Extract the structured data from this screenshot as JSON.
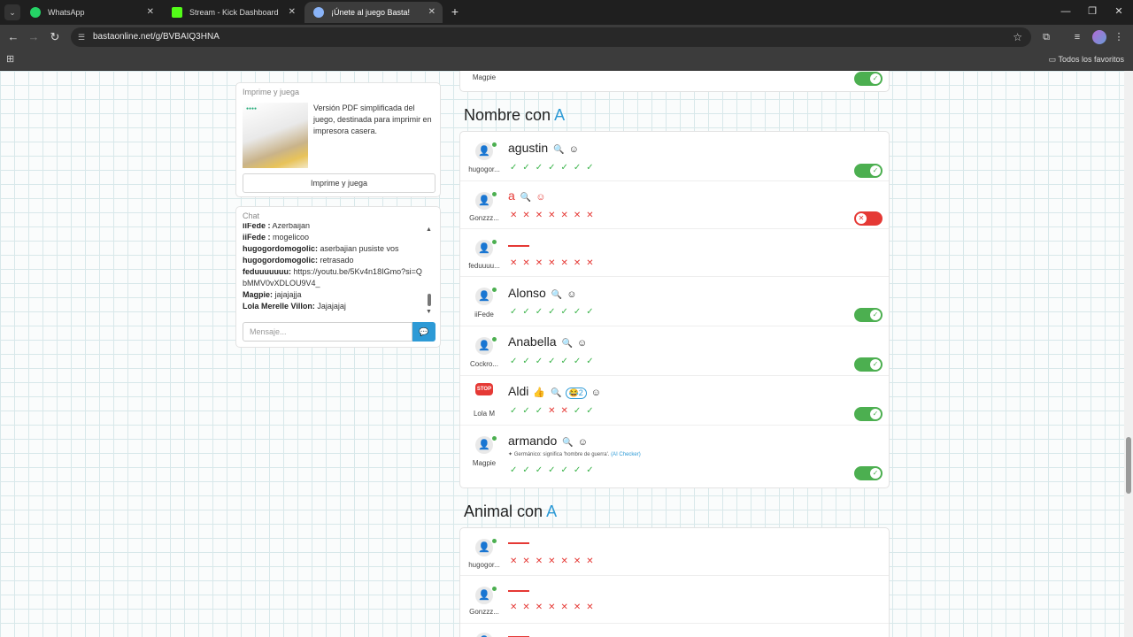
{
  "browser": {
    "tabs": [
      {
        "title": "WhatsApp",
        "icon": "whatsapp-icon",
        "color": "#25d366"
      },
      {
        "title": "Stream - Kick Dashboard",
        "icon": "kick-icon",
        "color": "#53fc18"
      },
      {
        "title": "¡Únete al juego Basta!",
        "icon": "globe-icon",
        "color": "#8ab4f8"
      }
    ],
    "url": "bastaonline.net/g/BVBAIQ3HNA",
    "bookmarks_label": "Todos los favoritos"
  },
  "print_card": {
    "title": "Imprime y juega",
    "description": "Versión PDF simplificada del juego, destinada para imprimir en impresora casera.",
    "button": "Imprime y juega"
  },
  "chat": {
    "title": "Chat",
    "messages": [
      {
        "user": "iiFede :",
        "text": "Azerbaijan"
      },
      {
        "user": "iiFede :",
        "text": "mogelicoo"
      },
      {
        "user": "hugogordomogolic:",
        "text": "aserbajian pusiste vos"
      },
      {
        "user": "hugogordomogolic:",
        "text": "retrasado"
      },
      {
        "user": "feduuuuuuu:",
        "text": "https://youtu.be/5Kv4n18IGmo?si=QbMMV0vXDLOU9V4_"
      },
      {
        "user": "Magpie:",
        "text": "jajajajja"
      },
      {
        "user": "Lola Merelle Villon:",
        "text": "Jajajajaj"
      }
    ],
    "placeholder": "Mensaje..."
  },
  "top_row": {
    "user": "Magpie",
    "marks": [
      "ok",
      "ok",
      "ok",
      "ok",
      "ok",
      "ok",
      "ok"
    ]
  },
  "section_nombre": {
    "title_prefix": "Nombre con ",
    "letter": "A",
    "rows": [
      {
        "user": "hugogor...",
        "word": "agustin",
        "marks": [
          "ok",
          "ok",
          "ok",
          "ok",
          "ok",
          "ok",
          "ok"
        ],
        "toggle": "on",
        "emoji_react": true
      },
      {
        "user": "Gonzzz...",
        "word": "a",
        "marks": [
          "no",
          "no",
          "no",
          "no",
          "no",
          "no",
          "no"
        ],
        "toggle": "off",
        "red": true,
        "emoji_react": true
      },
      {
        "user": "feduuuu...",
        "word": "",
        "marks": [
          "no",
          "no",
          "no",
          "no",
          "no",
          "no",
          "no"
        ],
        "toggle": "none"
      },
      {
        "user": "iiFede",
        "word": "Alonso",
        "marks": [
          "ok",
          "ok",
          "ok",
          "ok",
          "ok",
          "ok",
          "ok"
        ],
        "toggle": "on",
        "emoji_react": true
      },
      {
        "user": "Cockro...",
        "word": "Anabella",
        "marks": [
          "ok",
          "ok",
          "ok",
          "ok",
          "ok",
          "ok",
          "ok"
        ],
        "toggle": "on",
        "emoji_react": true
      },
      {
        "user": "Lola M",
        "word": "Aldi",
        "marks": [
          "ok",
          "ok",
          "ok",
          "no",
          "no",
          "ok",
          "ok"
        ],
        "toggle": "on",
        "stop": true,
        "badge": "😂2",
        "extra_emoji": "👍",
        "emoji_react": true
      },
      {
        "user": "Magpie",
        "word": "armando",
        "note": "Germánico: significa 'hombre de guerra'.",
        "note_tag": "(AI Checker)",
        "marks": [
          "ok",
          "ok",
          "ok",
          "ok",
          "ok",
          "ok",
          "ok"
        ],
        "toggle": "on",
        "emoji_react": true
      }
    ]
  },
  "section_animal": {
    "title_prefix": "Animal con ",
    "letter": "A",
    "rows": [
      {
        "user": "hugogor...",
        "marks": [
          "no",
          "no",
          "no",
          "no",
          "no",
          "no",
          "no"
        ]
      },
      {
        "user": "Gonzzz...",
        "marks": [
          "no",
          "no",
          "no",
          "no",
          "no",
          "no",
          "no"
        ]
      }
    ]
  },
  "colors": {
    "accent": "#2d9ad6",
    "ok": "#3cb44b",
    "no": "#e53935"
  }
}
